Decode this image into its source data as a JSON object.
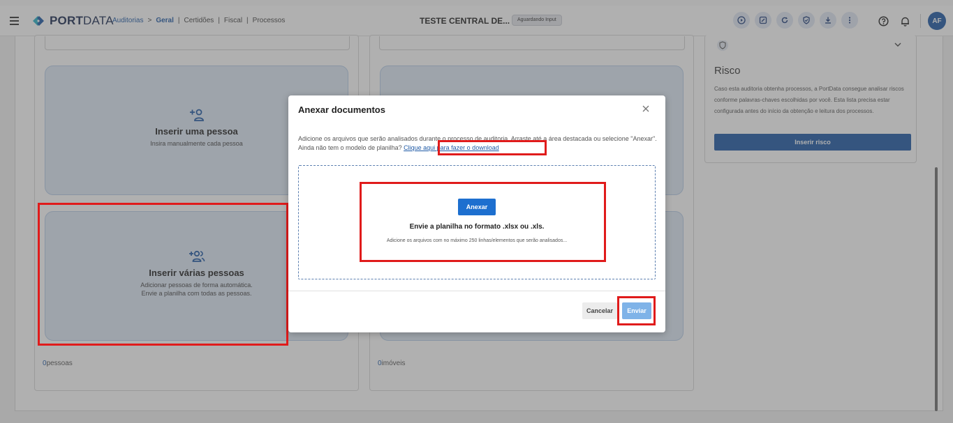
{
  "header": {
    "logo_bold": "PORT",
    "logo_light": "DATA",
    "breadcrumb": {
      "root": "Auditorias",
      "arrow": ">",
      "active": "Geral",
      "items": [
        "Certidões",
        "Fiscal",
        "Processos"
      ],
      "separator": "|"
    },
    "title": "TESTE CENTRAL DE...",
    "status_badge": "Aguardando Input",
    "icons": [
      "play-icon",
      "edit-icon",
      "refresh-icon",
      "shield-icon",
      "download-icon",
      "more-vertical-icon",
      "help-icon",
      "bell-icon"
    ],
    "avatar_initials": "AF"
  },
  "cards": {
    "single": {
      "title": "Inserir uma pessoa",
      "subtitle": "Insira manualmente cada pessoa"
    },
    "multiple": {
      "title": "Inserir várias pessoas",
      "subtitle_line1": "Adicionar pessoas de forma automática.",
      "subtitle_line2": "Envie a planilha com todas as pessoas."
    },
    "people_count": "0",
    "people_label": "pessoas",
    "property_count": "0",
    "property_label": "imóveis"
  },
  "risk": {
    "title": "Risco",
    "description": "Caso esta auditoria obtenha processos, a PortData consegue analisar riscos conforme palavras-chaves escolhidas por você. Esta lista precisa estar configurada antes do início da obtenção e leitura dos processos.",
    "button": "Inserir risco"
  },
  "modal": {
    "title": "Anexar documentos",
    "description": "Adicione os arquivos que serão analisados durante o processo de auditoria. Arraste até a área destacada ou selecione \"Anexar\". Ainda não tem o modelo de planilha?",
    "download_link": "Clique aqui para fazer o download",
    "attach_button": "Anexar",
    "drop_main": "Envie a planilha no formato .xlsx ou .xls.",
    "drop_hint": "Adicione os arquivos com no máximo 250 linhas/elementos que serão analisados...",
    "cancel_button": "Cancelar",
    "send_button": "Enviar"
  },
  "colors": {
    "brand_blue": "#1f5aa6",
    "card_bg": "#dfe9f6",
    "highlight_red": "#e01b1b",
    "send_disabled": "#7fb3e8"
  }
}
